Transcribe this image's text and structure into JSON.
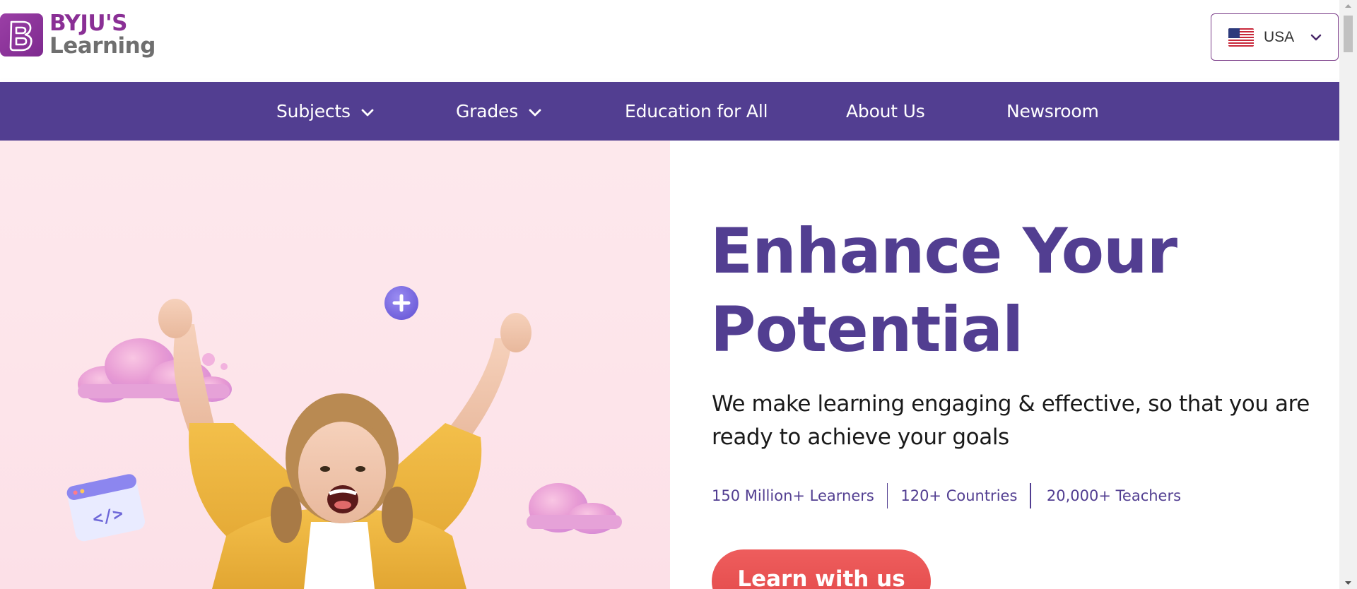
{
  "brand": {
    "line1": "BYJU'S",
    "line2": "Learning",
    "mark_letter": "B",
    "primary_color": "#523e91",
    "logo_color": "#8a2f95"
  },
  "country_selector": {
    "label": "USA",
    "flag_icon": "us-flag-icon",
    "chevron_icon": "chevron-down-icon"
  },
  "nav": {
    "items": [
      {
        "label": "Subjects",
        "has_dropdown": true
      },
      {
        "label": "Grades",
        "has_dropdown": true
      },
      {
        "label": "Education for All",
        "has_dropdown": false
      },
      {
        "label": "About Us",
        "has_dropdown": false
      },
      {
        "label": "Newsroom",
        "has_dropdown": false
      }
    ]
  },
  "hero": {
    "headline_line1": "Enhance Your",
    "headline_line2": "Potential",
    "subtext": "We make learning engaging & effective, so that you are ready to achieve your goals",
    "stats": [
      "150 Million+ Learners",
      "120+ Countries",
      "20,000+ Teachers"
    ],
    "cta_label": "Learn with us",
    "cta_color": "#e24848",
    "hero_bg_color": "#fde4ea"
  }
}
